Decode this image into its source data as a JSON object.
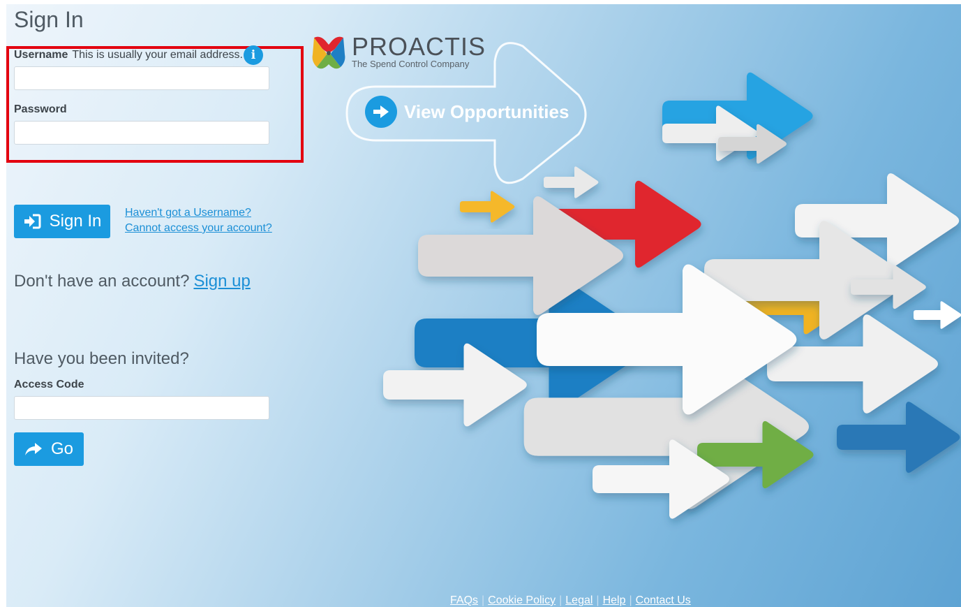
{
  "page": {
    "title": "Sign In"
  },
  "form": {
    "username_label": "Username",
    "username_hint": "This is usually your email address.",
    "username_value": "",
    "password_label": "Password",
    "password_value": "",
    "sign_in_label": "Sign In",
    "forgot_username_link": "Haven't got a Username?",
    "cannot_access_link": "Cannot access your account?"
  },
  "signup": {
    "prompt": "Don't have an account?",
    "link": "Sign up"
  },
  "invite": {
    "heading": "Have you been invited?",
    "access_code_label": "Access Code",
    "access_code_value": "",
    "go_label": "Go"
  },
  "brand": {
    "name": "PROACTIS",
    "tagline": "The Spend Control Company"
  },
  "hero": {
    "cta_label": "View Opportunities"
  },
  "footer": {
    "links": [
      "FAQs",
      "Cookie Policy",
      "Legal",
      "Help",
      "Contact Us"
    ]
  },
  "colors": {
    "accent": "#1b9be0",
    "link": "#1b8fd6",
    "focus_outline": "#e3000f",
    "arrow_red": "#e0262e",
    "arrow_yellow": "#f0b323",
    "arrow_green": "#6fae45",
    "arrow_blue": "#1f7fc4"
  },
  "icons": {
    "info": "info-icon",
    "sign_in": "sign-in-icon",
    "go": "share-arrow-icon",
    "cta": "arrow-right-circle-icon"
  }
}
